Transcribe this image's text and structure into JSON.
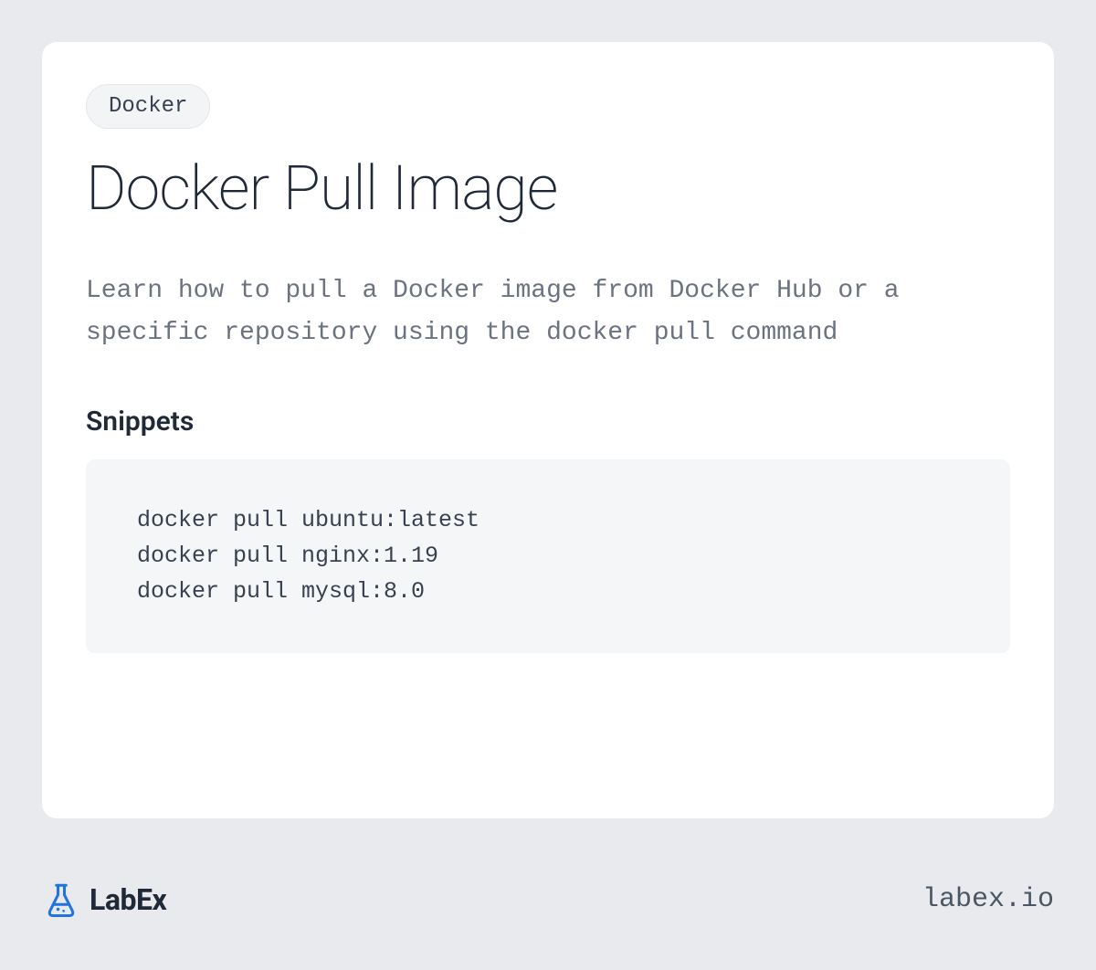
{
  "tag": "Docker",
  "title": "Docker Pull Image",
  "description": "Learn how to pull a Docker image from Docker Hub or a specific repository using the docker pull command",
  "snippets_heading": "Snippets",
  "code": "docker pull ubuntu:latest\ndocker pull nginx:1.19\ndocker pull mysql:8.0",
  "brand": "LabEx",
  "site_url": "labex.io",
  "colors": {
    "background": "#e8eaed",
    "card": "#ffffff",
    "accent": "#2173de"
  }
}
